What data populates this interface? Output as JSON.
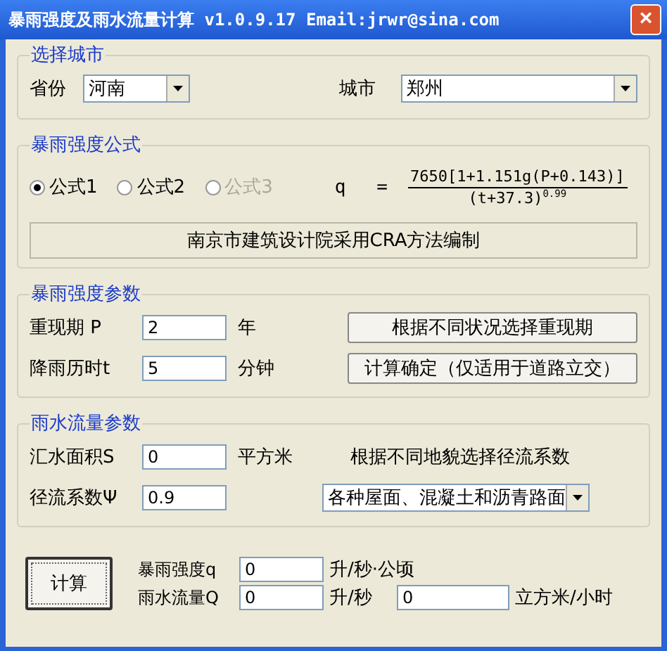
{
  "window": {
    "title": "暴雨强度及雨水流量计算 v1.0.9.17 Email:jrwr@sina.com",
    "close": "×"
  },
  "city_group": {
    "title": "选择城市",
    "province_label": "省份",
    "province": "河南",
    "city_label": "城市",
    "city": "郑州"
  },
  "formula_group": {
    "title": "暴雨强度公式",
    "options": [
      {
        "label": "公式1",
        "selected": true,
        "disabled": false
      },
      {
        "label": "公式2",
        "selected": false,
        "disabled": false
      },
      {
        "label": "公式3",
        "selected": false,
        "disabled": true
      }
    ],
    "lhs": "q",
    "equals": "=",
    "numerator": "7650[1+1.151g(P+0.143)]",
    "denominator": "(t+37.3)$^{0.99}$",
    "source": "南京市建筑设计院采用CRA方法编制"
  },
  "intensity_group": {
    "title": "暴雨强度参数",
    "rows": [
      {
        "label": "重现期  P",
        "value": "2",
        "unit": "年",
        "button": "根据不同状况选择重现期"
      },
      {
        "label": "降雨历时t",
        "value": "5",
        "unit": "分钟",
        "button": "计算确定（仅适用于道路立交）"
      }
    ]
  },
  "flow_group": {
    "title": "雨水流量参数",
    "area_label": "汇水面积S",
    "area": "0",
    "area_unit": "平方米",
    "hint": "根据不同地貌选择径流系数",
    "coef_label": "径流系数Ψ",
    "coef": "0.9",
    "surface": "各种屋面、混凝土和沥青路面"
  },
  "results": {
    "button": "计算",
    "q_label": "暴雨强度q",
    "q": "0",
    "q_unit": "升/秒·公顷",
    "Q_label": "雨水流量Q",
    "Q": "0",
    "Q_unit": "升/秒",
    "Q_hour": "0",
    "Q_hour_unit": "立方米/小时"
  }
}
